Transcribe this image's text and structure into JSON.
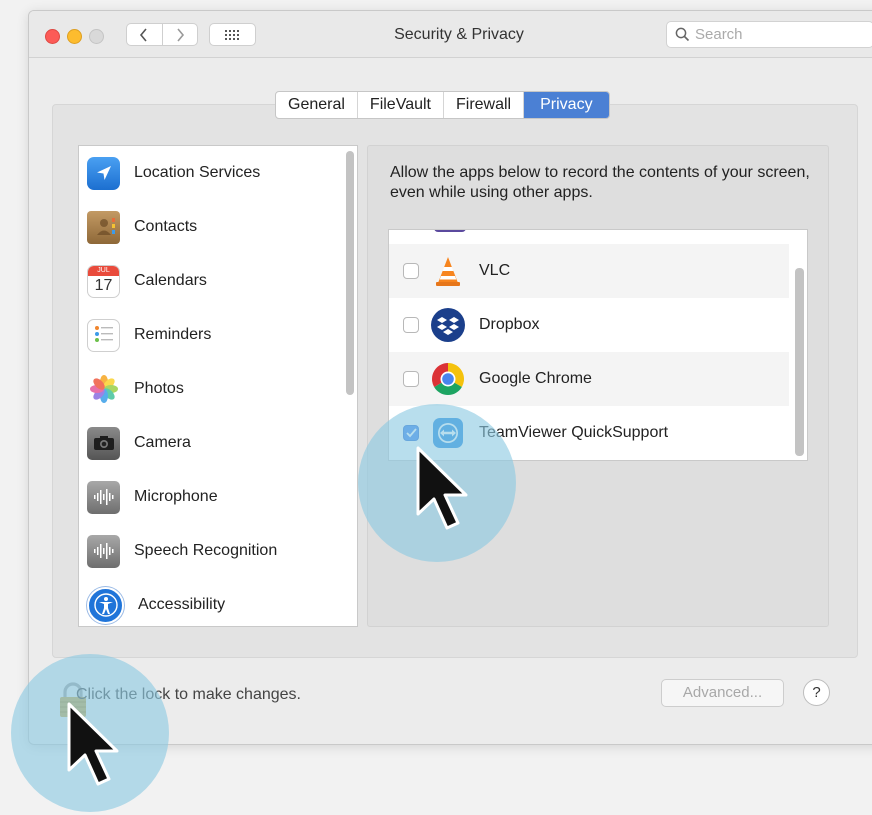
{
  "window": {
    "title": "Security & Privacy",
    "search_placeholder": "Search"
  },
  "tabs": [
    {
      "label": "General"
    },
    {
      "label": "FileVault"
    },
    {
      "label": "Firewall"
    },
    {
      "label": "Privacy",
      "active": true
    }
  ],
  "categories": [
    {
      "label": "Location Services",
      "icon": "location-arrow-icon"
    },
    {
      "label": "Contacts",
      "icon": "contacts-book-icon"
    },
    {
      "label": "Calendars",
      "icon": "calendar-icon",
      "icon_text": "JUL",
      "icon_day": "17"
    },
    {
      "label": "Reminders",
      "icon": "reminders-list-icon"
    },
    {
      "label": "Photos",
      "icon": "photos-flower-icon"
    },
    {
      "label": "Camera",
      "icon": "camera-icon"
    },
    {
      "label": "Microphone",
      "icon": "microphone-waveform-icon"
    },
    {
      "label": "Speech Recognition",
      "icon": "speech-waveform-icon"
    },
    {
      "label": "Accessibility",
      "icon": "accessibility-person-icon"
    }
  ],
  "screen_recording": {
    "description": "Allow the apps below to record the contents of your screen, even while using other apps.",
    "apps": [
      {
        "name": "VLC",
        "checked": false,
        "icon": "vlc-cone-icon"
      },
      {
        "name": "Dropbox",
        "checked": false,
        "icon": "dropbox-icon"
      },
      {
        "name": "Google Chrome",
        "checked": false,
        "icon": "chrome-icon"
      },
      {
        "name": "TeamViewer QuickSupport",
        "checked": true,
        "icon": "teamviewer-icon"
      }
    ]
  },
  "footer": {
    "lock_text": "Click the lock to make changes.",
    "advanced_label": "Advanced...",
    "help_label": "?"
  },
  "colors": {
    "accent": "#4b80d4",
    "highlight_circle": "#8ccae2",
    "checkbox_on": "#3b82f0"
  }
}
